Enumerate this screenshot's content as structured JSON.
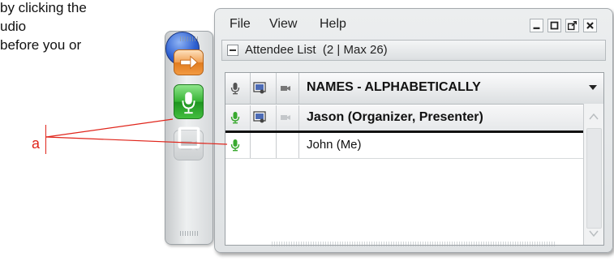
{
  "doc": {
    "lines": [
      "by clicking the",
      "udio",
      "before you or"
    ]
  },
  "annotation": {
    "label": "a",
    "color": "#e0251b"
  },
  "panel": {
    "buttons": [
      {
        "icon": "arrow-right-icon",
        "color": "#f0a052"
      },
      {
        "icon": "microphone-icon",
        "color": "#35b233"
      },
      {
        "icon": "video-camera-icon",
        "color": "#cdd0d2"
      },
      {
        "icon": "share-screen-icon",
        "color": "#2d5fd0"
      }
    ]
  },
  "window": {
    "menu": [
      "File",
      "View",
      "Help"
    ],
    "controls": [
      "minimize-icon",
      "restore-icon",
      "popout-icon",
      "close-icon"
    ]
  },
  "attendee_list": {
    "title": "Attendee List",
    "count": "(2 | Max 26)",
    "header": {
      "names": "NAMES - ALPHABETICALLY"
    },
    "rows": [
      {
        "name": "Jason (Organizer, Presenter)",
        "mic": true,
        "presenter": true,
        "video": true
      },
      {
        "name": "John (Me)",
        "mic": true,
        "presenter": false,
        "video": false
      }
    ]
  }
}
